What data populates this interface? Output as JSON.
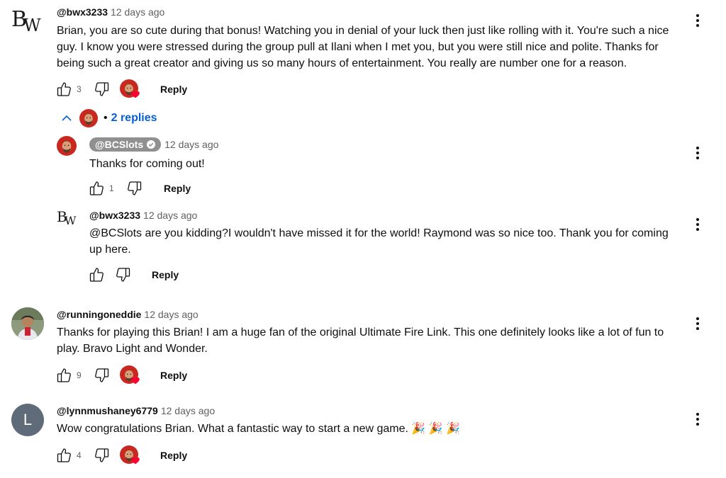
{
  "comments": [
    {
      "author": "@bwx3233",
      "time": "12 days ago",
      "avatar_text": "BW",
      "text_lines": [
        "Brian, you are so cute during that bonus! Watching you in denial of your luck then just like rolling with it. You're such a nice",
        "guy. I know you were stressed during the group pull at Ilani when I met you, but you were still nice and polite. Thanks for",
        "being such a great creator and giving us so many hours of entertainment. You really are number one for a reason."
      ],
      "likes": "3",
      "reply_label": "Reply",
      "replies_toggle": "2 replies"
    },
    {
      "author": "@runningoneddie",
      "time": "12 days ago",
      "text_lines": [
        "Thanks for playing this Brian! I am a huge fan of the original Ultimate Fire Link.  This one definitely looks like a lot of fun to",
        "play.  Bravo Light and Wonder."
      ],
      "likes": "9",
      "reply_label": "Reply"
    },
    {
      "author": "@lynnmushaney6779",
      "time": "12 days ago",
      "avatar_letter": "L",
      "text_lines": [
        "Wow congratulations Brian. What a fantastic way to start a new game. 🎉 🎉 🎉"
      ],
      "likes": "4",
      "reply_label": "Reply"
    }
  ],
  "replies": [
    {
      "author": "@BCSlots",
      "time": "12 days ago",
      "text_lines": [
        "Thanks for coming out!"
      ],
      "likes": "1",
      "reply_label": "Reply"
    },
    {
      "author": "@bwx3233",
      "time": "12 days ago",
      "avatar_text": "BW",
      "text_lines": [
        "@BCSlots  are you kidding?I wouldn't have missed it for the world! Raymond was so nice too. Thank you for coming",
        "up here."
      ],
      "likes": "",
      "reply_label": "Reply"
    }
  ],
  "colors": {
    "link_blue": "#065fd4",
    "owner_pill": "#909090",
    "heart_red": "#ff0033",
    "avatar_L_bg": "#5f6b78"
  }
}
